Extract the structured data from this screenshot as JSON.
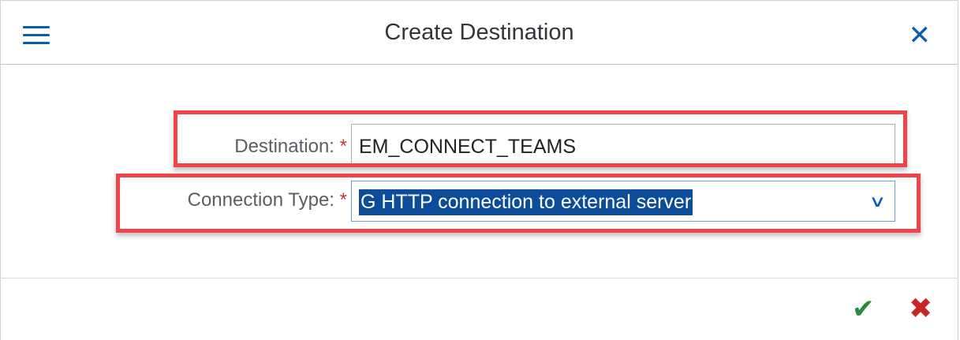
{
  "header": {
    "title": "Create Destination",
    "menu_icon": "hamburger-menu-icon",
    "close_icon": "close-icon"
  },
  "form": {
    "destination": {
      "label": "Destination:",
      "required": "*",
      "value": "EM_CONNECT_TEAMS"
    },
    "connection_type": {
      "label": "Connection Type:",
      "required": "*",
      "value": "G HTTP connection to external server"
    }
  },
  "footer": {
    "confirm_icon": "checkmark-icon",
    "cancel_icon": "cancel-x-icon"
  },
  "colors": {
    "accent": "#0a5cad",
    "annotation": "#f0444a",
    "confirm": "#2b8a3e",
    "cancel": "#c62828"
  }
}
